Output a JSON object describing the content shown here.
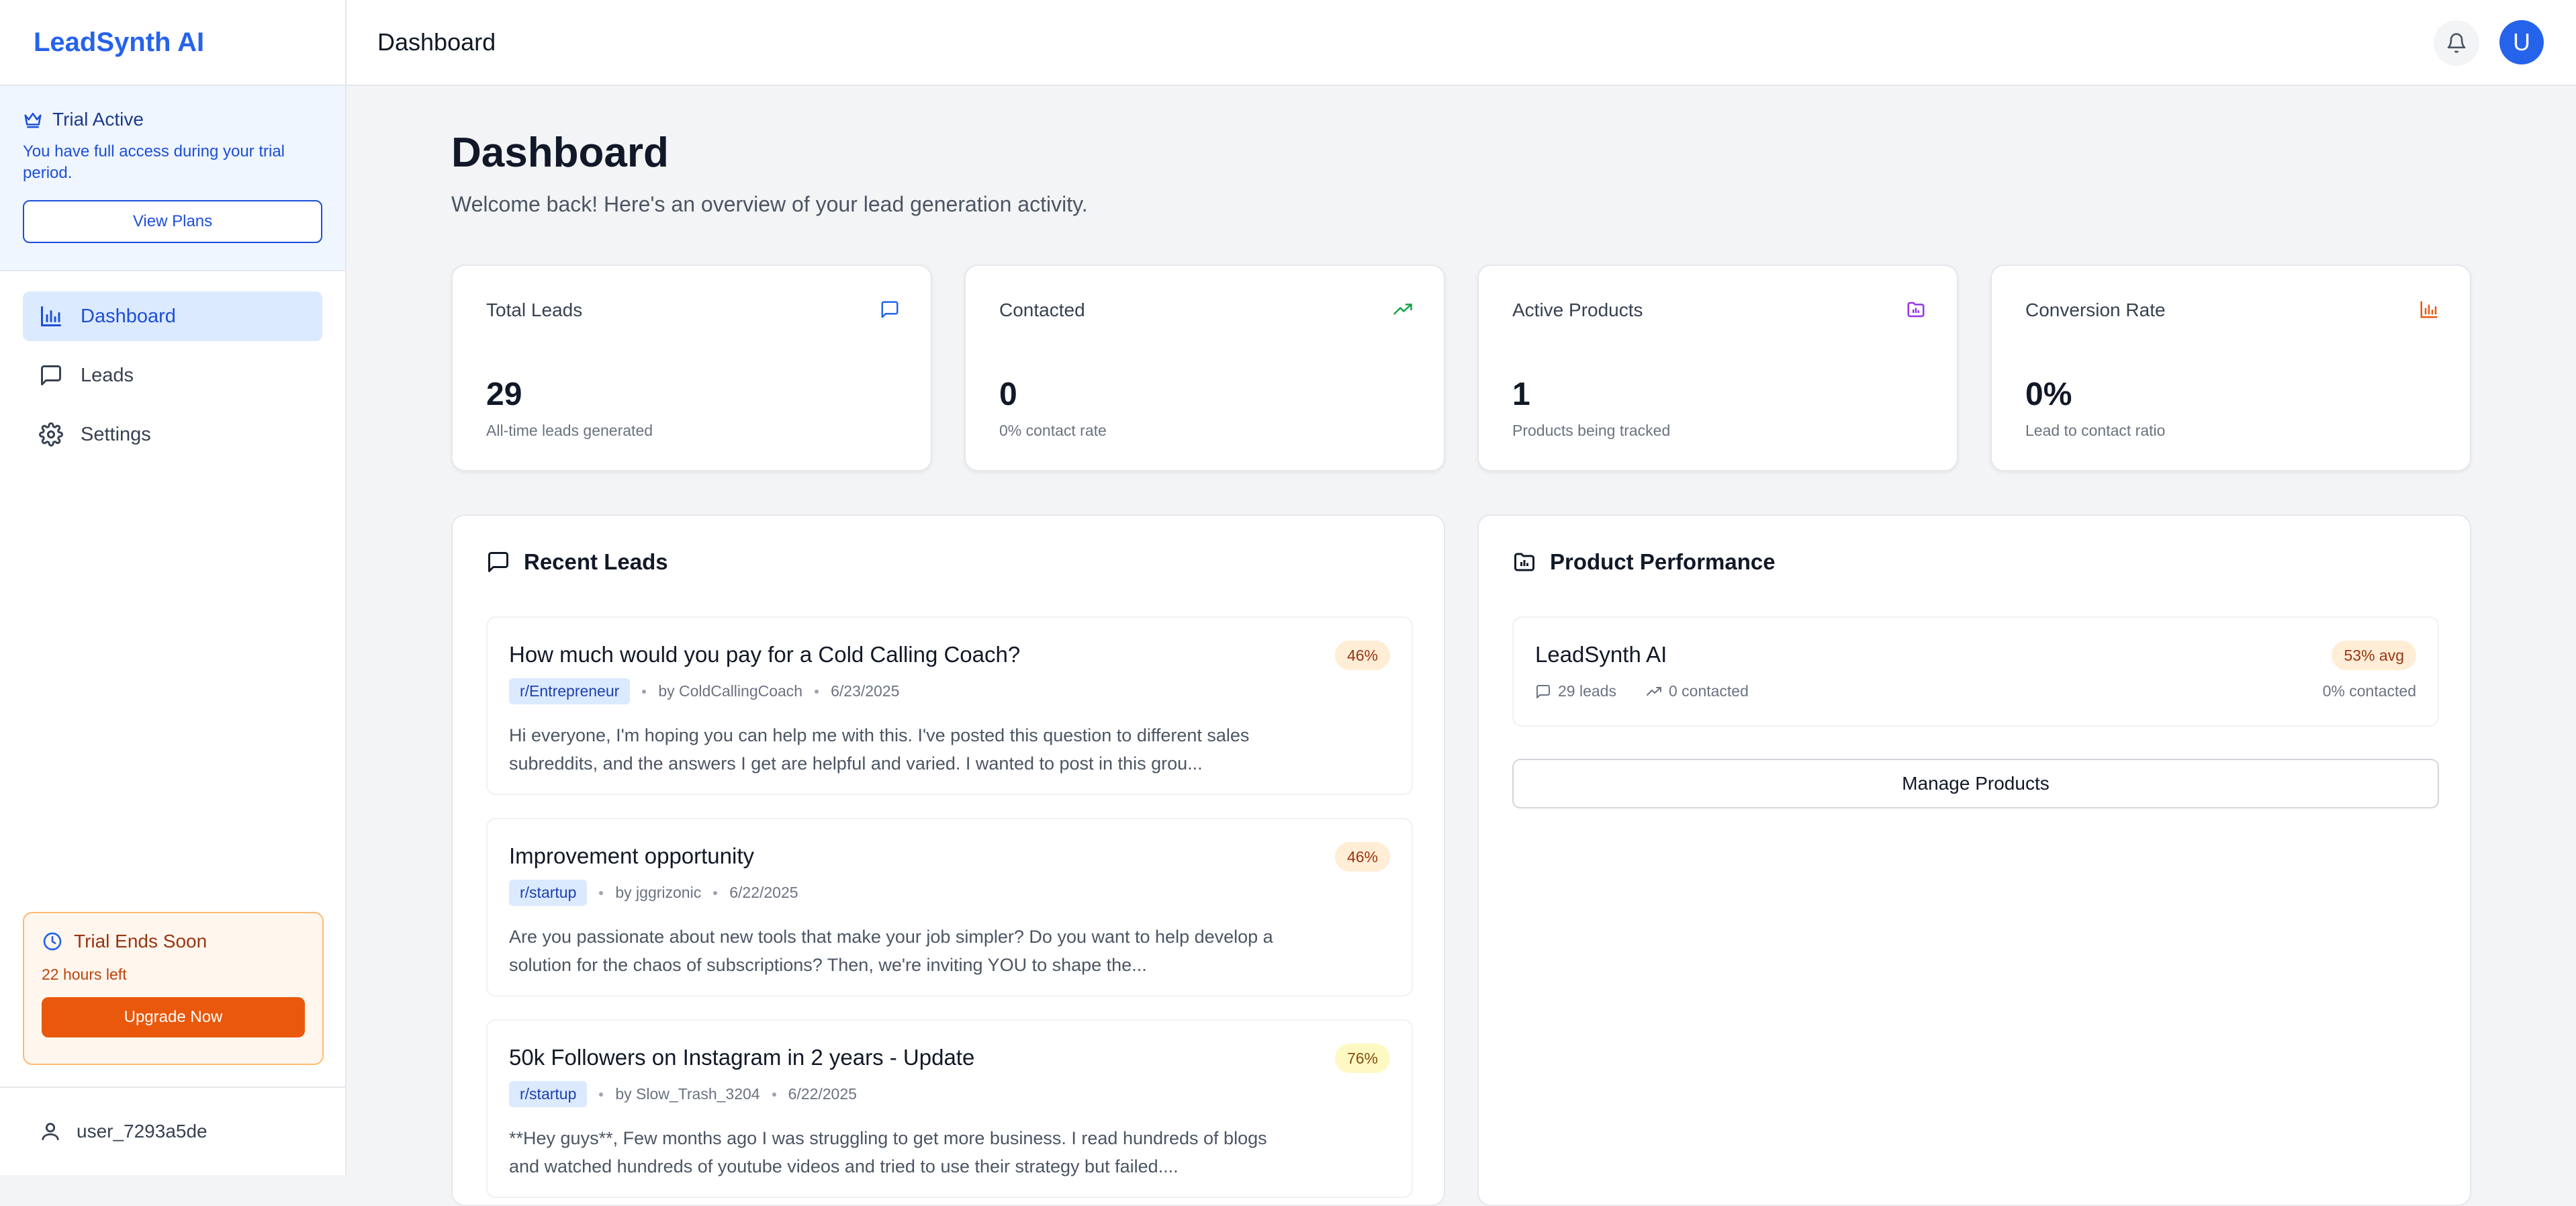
{
  "app": {
    "name": "LeadSynth AI"
  },
  "trial": {
    "title": "Trial Active",
    "description": "You have full access during your trial period.",
    "button": "View Plans"
  },
  "nav": {
    "items": [
      {
        "label": "Dashboard",
        "icon": "bar-chart-icon",
        "active": true
      },
      {
        "label": "Leads",
        "icon": "message-icon",
        "active": false
      },
      {
        "label": "Settings",
        "icon": "gear-icon",
        "active": false
      }
    ]
  },
  "trial_ends": {
    "title": "Trial Ends Soon",
    "time_left": "22 hours left",
    "button": "Upgrade Now"
  },
  "user": {
    "name": "user_7293a5de",
    "initial": "U"
  },
  "header": {
    "title": "Dashboard"
  },
  "page": {
    "title": "Dashboard",
    "subtitle": "Welcome back! Here's an overview of your lead generation activity."
  },
  "stats": [
    {
      "label": "Total Leads",
      "value": "29",
      "sub": "All-time leads generated",
      "icon": "message-icon",
      "color": "#2563eb"
    },
    {
      "label": "Contacted",
      "value": "0",
      "sub": "0% contact rate",
      "icon": "trending-up-icon",
      "color": "#16a34a"
    },
    {
      "label": "Active Products",
      "value": "1",
      "sub": "Products being tracked",
      "icon": "folder-chart-icon",
      "color": "#9333ea"
    },
    {
      "label": "Conversion Rate",
      "value": "0%",
      "sub": "Lead to contact ratio",
      "icon": "bar-chart-icon",
      "color": "#ea580c"
    }
  ],
  "recent_leads": {
    "title": "Recent Leads",
    "items": [
      {
        "title": "How much would you pay for a Cold Calling Coach?",
        "subreddit": "r/Entrepreneur",
        "author": "by ColdCallingCoach",
        "date": "6/23/2025",
        "score": "46%",
        "body": "Hi everyone, I'm hoping you can help me with this. I've posted this question to different sales subreddits, and the answers I get are helpful and varied. I wanted to post in this grou..."
      },
      {
        "title": "Improvement opportunity",
        "subreddit": "r/startup",
        "author": "by jggrizonic",
        "date": "6/22/2025",
        "score": "46%",
        "body": "Are you passionate about new tools that make your job simpler? Do you want to help develop a solution for the chaos of subscriptions? Then, we're inviting YOU to shape the..."
      },
      {
        "title": "50k Followers on Instagram in 2 years - Update",
        "subreddit": "r/startup",
        "author": "by Slow_Trash_3204",
        "date": "6/22/2025",
        "score": "76%",
        "body": "**Hey guys**, Few months ago I was struggling to get more business. I read hundreds of blogs and watched hundreds of youtube videos and tried to use their strategy but failed...."
      }
    ]
  },
  "product_performance": {
    "title": "Product Performance",
    "product": {
      "name": "LeadSynth AI",
      "leads": "29 leads",
      "contacted": "0 contacted",
      "avg": "53% avg",
      "contacted_pct": "0% contacted"
    },
    "button": "Manage Products"
  },
  "colors": {
    "accent": "#2563eb",
    "orange": "#ea580c"
  }
}
